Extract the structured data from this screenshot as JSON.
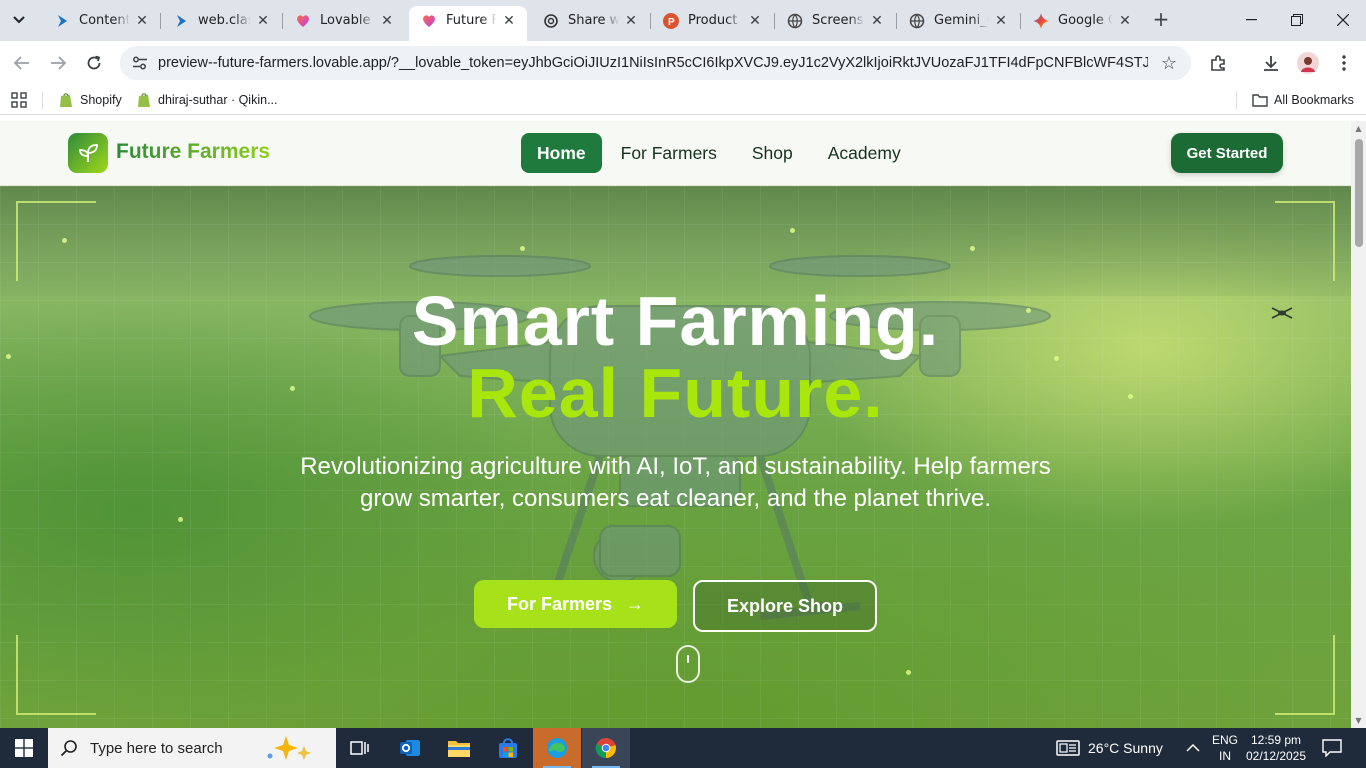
{
  "browser": {
    "tabs": [
      {
        "title": "Content s",
        "active": false
      },
      {
        "title": "web.class",
        "active": false
      },
      {
        "title": "Lovable -",
        "active": false
      },
      {
        "title": "Future Fa",
        "active": true
      },
      {
        "title": "Share wel",
        "active": false
      },
      {
        "title": "Product H",
        "active": false
      },
      {
        "title": "Screensho",
        "active": false
      },
      {
        "title": "Gemini_G",
        "active": false
      },
      {
        "title": "Google G",
        "active": false
      }
    ],
    "url": "preview--future-farmers.lovable.app/?__lovable_token=eyJhbGciOiJIUzI1NiIsInR5cCI6IkpXVCJ9.eyJ1c2VyX2lkIjoiRktJVUozaFJ1TFI4dFpCNFBlcWF4STJwblRVMilsI...",
    "bookmarks": [
      {
        "label": "Shopify"
      },
      {
        "label": "dhiraj-suthar · Qikin..."
      }
    ],
    "all_bookmarks_label": "All Bookmarks"
  },
  "site": {
    "brand": "Future Farmers",
    "nav": [
      {
        "label": "Home",
        "active": true
      },
      {
        "label": "For Farmers",
        "active": false
      },
      {
        "label": "Shop",
        "active": false
      },
      {
        "label": "Academy",
        "active": false
      }
    ],
    "cta_label": "Get Started",
    "hero": {
      "title_line1": "Smart Farming.",
      "title_line2": "Real Future.",
      "subtitle": "Revolutionizing agriculture with AI, IoT, and sustainability. Help farmers grow smarter, consumers eat cleaner, and the planet thrive.",
      "primary_button": "For Farmers",
      "primary_button_icon": "→",
      "secondary_button": "Explore Shop"
    },
    "colors": {
      "brand_green": "#1f7a3d",
      "lime_accent": "#a6e11a"
    }
  },
  "taskbar": {
    "search_placeholder": "Type here to search",
    "weather": "26°C  Sunny",
    "lang_line1": "ENG",
    "lang_line2": "IN",
    "time": "12:59 pm",
    "date": "02/12/2025"
  }
}
